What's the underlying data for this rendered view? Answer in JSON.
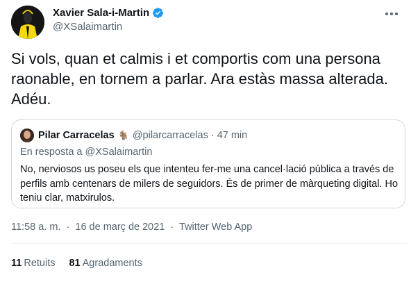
{
  "author": {
    "name": "Xavier Sala-i-Martin",
    "handle": "@XSalaimartin"
  },
  "tweet": {
    "text": "Si vols, quan et calmis i et comportis com una persona raonable, en tornem a parlar. Ara estàs massa alterada. Adéu."
  },
  "quote": {
    "name": "Pilar Carracelas",
    "emoji": "🐐",
    "handle": "@pilarcarracelas",
    "separator": "·",
    "time": "47 min",
    "reply_prefix": "En resposta a",
    "reply_to": "@XSalaimartin",
    "text": "No, nerviosos us poseu els que intenteu fer-me una cancel·lació pública a través de perfils amb centenars de milers de seguidors. És de primer de màrqueting digital. Ho teniu clar, matxirulos."
  },
  "meta": {
    "time": "11:58 a. m.",
    "separator": "·",
    "date": "16 de març de 2021",
    "app": "Twitter Web App"
  },
  "stats": {
    "retweets_count": "11",
    "retweets_label": "Retuits",
    "likes_count": "81",
    "likes_label": "Agradaments"
  },
  "colors": {
    "verified": "#1d9bf0",
    "secondary_text": "#536471",
    "border": "#cfd9de",
    "avatar_jacket": "#f5d90a"
  },
  "icons": {
    "verified": "verified-badge-icon",
    "more": "more-dots-icon"
  }
}
